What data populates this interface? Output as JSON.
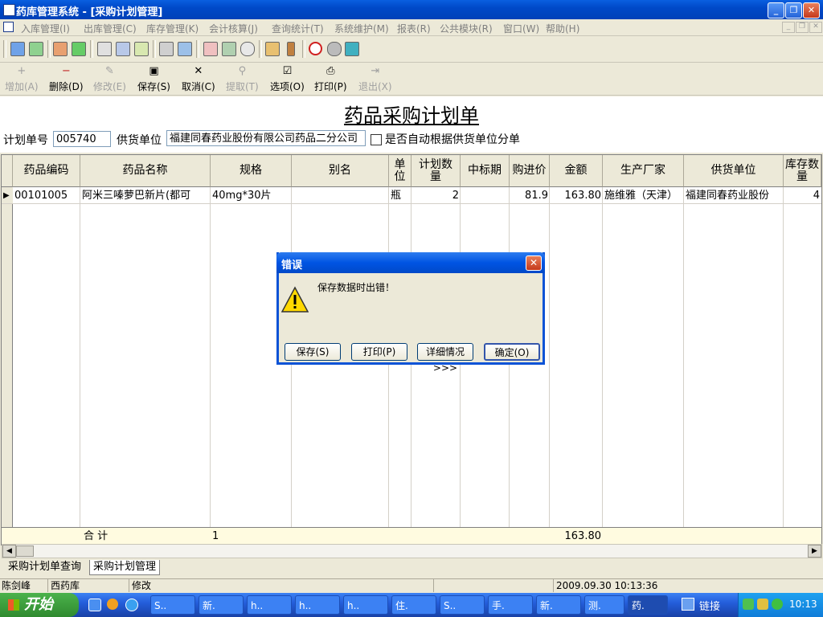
{
  "window": {
    "title": "药库管理系统 - [采购计划管理]",
    "minimize": "_",
    "restore": "❐",
    "close": "✕"
  },
  "menu": [
    "入库管理(I)",
    "出库管理(C)",
    "库存管理(K)",
    "会计核算(J)",
    "查询统计(T)",
    "系统维护(M)",
    "报表(R)",
    "公共模块(R)",
    "窗口(W)",
    "帮助(H)"
  ],
  "actions": {
    "add": {
      "label": "增加(A)",
      "icon": "+"
    },
    "delete": {
      "label": "删除(D)",
      "icon": "−"
    },
    "modify": {
      "label": "修改(E)",
      "icon": "✎"
    },
    "save": {
      "label": "保存(S)",
      "icon": "▣"
    },
    "cancel": {
      "label": "取消(C)",
      "icon": "✕"
    },
    "extract": {
      "label": "提取(T)",
      "icon": "⚲"
    },
    "options": {
      "label": "选项(O)",
      "icon": "☑"
    },
    "print": {
      "label": "打印(P)",
      "icon": "⎙"
    },
    "exit": {
      "label": "退出(X)",
      "icon": "⇥"
    }
  },
  "form": {
    "title": "药品采购计划单",
    "plan_no_label": "计划单号",
    "plan_no": "005740",
    "supplier_label": "供货单位",
    "supplier": "福建同春药业股份有限公司药品二分公司",
    "auto_split_label": "是否自动根据供货单位分单"
  },
  "table": {
    "headers": {
      "code": "药品编码",
      "name": "药品名称",
      "spec": "规格",
      "alias": "别名",
      "unit": "单位",
      "qty": "计划数量",
      "bid": "中标期",
      "price": "购进价",
      "amount": "金额",
      "maker": "生产厂家",
      "supplier": "供货单位",
      "stock": "库存数量"
    },
    "row": {
      "code": "00101005",
      "name": "阿米三嗪萝巴新片(都可",
      "spec": "40mg*30片",
      "alias": "",
      "unit": "瓶",
      "qty": "2",
      "bid": "",
      "price": "81.9",
      "amount": "163.80",
      "maker": "施维雅（天津）",
      "supplier": "福建同春药业股份",
      "stock": "4"
    },
    "total_label": "合  计",
    "total_spec": "1",
    "total_amount": "163.80"
  },
  "tabs": [
    "采购计划单查询",
    "采购计划管理"
  ],
  "status": {
    "user": "陈剑峰",
    "dept": "西药库",
    "mode": "修改",
    "time": "2009.09.30 10:13:36"
  },
  "dialog": {
    "title": "错误",
    "message": "保存数据时出错！",
    "save": "保存(S)",
    "print": "打印(P)",
    "details": "详细情况>>>",
    "ok": "确定(O)",
    "close": "✕"
  },
  "taskbar": {
    "start": "开始",
    "tasks": [
      "S..",
      "新.",
      "h..",
      "h..",
      "h..",
      "住.",
      "S..",
      "手.",
      "新.",
      "测.",
      "药."
    ],
    "links": "链接",
    "clock": "10:13"
  },
  "colors": {
    "titlebar": "#0054e3",
    "taskbar": "#245edb",
    "start": "#2f8a2f",
    "total_row": "#fffbe0"
  }
}
